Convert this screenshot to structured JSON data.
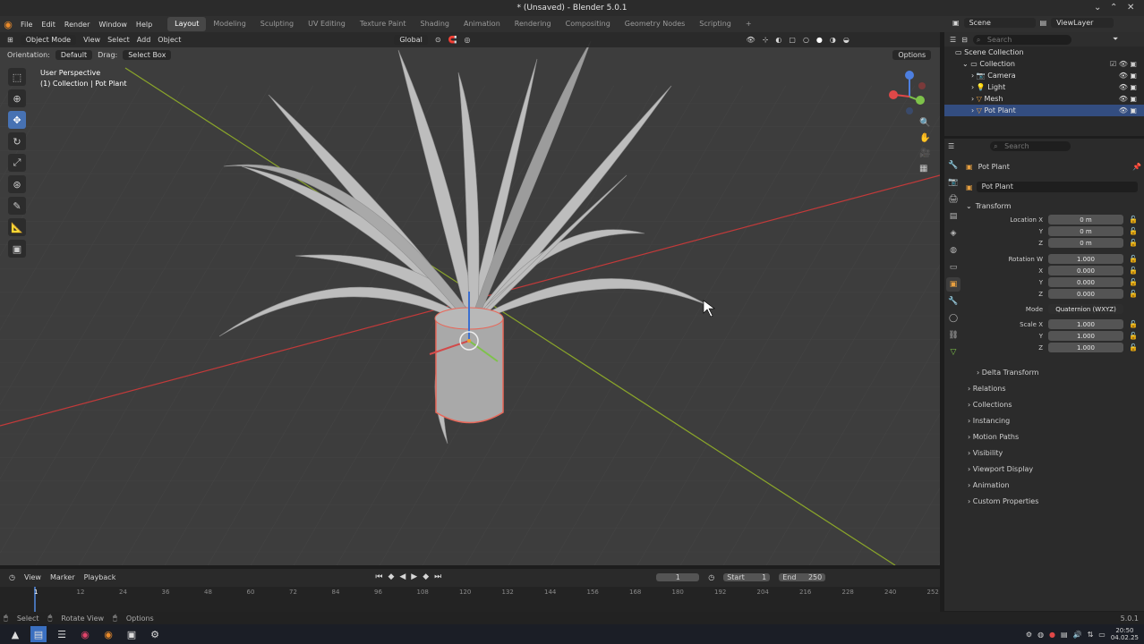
{
  "window": {
    "title": "* (Unsaved) - Blender 5.0.1"
  },
  "menu": [
    "File",
    "Edit",
    "Render",
    "Window",
    "Help"
  ],
  "workspaces": [
    "Layout",
    "Modeling",
    "Sculpting",
    "UV Editing",
    "Texture Paint",
    "Shading",
    "Animation",
    "Rendering",
    "Compositing",
    "Geometry Nodes",
    "Scripting"
  ],
  "active_workspace": "Layout",
  "scene": {
    "name": "Scene",
    "view_layer": "ViewLayer"
  },
  "viewport": {
    "mode": "Object Mode",
    "menus": [
      "View",
      "Select",
      "Add",
      "Object"
    ],
    "transform_orientation": "Global",
    "orientation_label": "Orientation:",
    "orientation_value": "Default",
    "drag_label": "Drag:",
    "drag_value": "Select Box",
    "options": "Options",
    "overlay_line1": "User Perspective",
    "overlay_line2": "(1) Collection | Pot Plant"
  },
  "outliner": {
    "search_placeholder": "Search",
    "root": "Scene Collection",
    "collection": "Collection",
    "items": [
      "Camera",
      "Light",
      "Mesh",
      "Pot Plant"
    ],
    "selected": "Pot Plant"
  },
  "properties": {
    "search_placeholder": "Search",
    "object_name": "Pot Plant",
    "datablock": "Pot Plant",
    "transform_header": "Transform",
    "location_x_label": "Location X",
    "location": [
      "0 m",
      "0 m",
      "0 m"
    ],
    "rotation_w_label": "Rotation W",
    "rotation": [
      "1.000",
      "0.000",
      "0.000",
      "0.000"
    ],
    "mode_label": "Mode",
    "mode_value": "Quaternion (WXYZ)",
    "scale_x_label": "Scale X",
    "scale": [
      "1.000",
      "1.000",
      "1.000"
    ],
    "axis": [
      "X",
      "Y",
      "Z",
      "W"
    ],
    "delta": "Delta Transform",
    "sections": [
      "Relations",
      "Collections",
      "Instancing",
      "Motion Paths",
      "Visibility",
      "Viewport Display",
      "Animation",
      "Custom Properties"
    ]
  },
  "timeline": {
    "menus": [
      "View",
      "Marker",
      "Playback"
    ],
    "current_frame": "1",
    "start_label": "Start",
    "start": "1",
    "end_label": "End",
    "end": "250",
    "ticks": [
      "1",
      "12",
      "24",
      "36",
      "48",
      "60",
      "72",
      "84",
      "96",
      "108",
      "120",
      "132",
      "144",
      "156",
      "168",
      "180",
      "192",
      "204",
      "216",
      "228",
      "240",
      "252"
    ]
  },
  "status": {
    "items": [
      "Select",
      "Rotate View",
      "Options"
    ],
    "version": "5.0.1"
  },
  "clock": {
    "time": "20:50",
    "date": "04.02.25"
  },
  "colors": {
    "accent": "#4772b3",
    "x_axis": "#c23a3a",
    "y_axis": "#8aa52a",
    "selection": "#e8685a"
  }
}
